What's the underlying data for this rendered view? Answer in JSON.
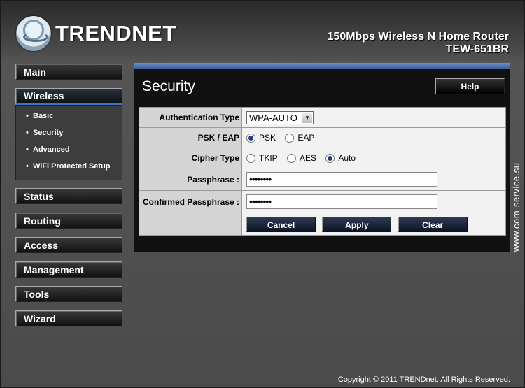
{
  "header": {
    "brand": "TRENDNET",
    "product_line": "150Mbps Wireless N Home Router",
    "model": "TEW-651BR"
  },
  "nav": {
    "main": "Main",
    "wireless": "Wireless",
    "wireless_sub": {
      "basic": "Basic",
      "security": "Security",
      "advanced": "Advanced",
      "wps": "WiFi Protected Setup"
    },
    "status": "Status",
    "routing": "Routing",
    "access": "Access",
    "management": "Management",
    "tools": "Tools",
    "wizard": "Wizard",
    "bullet": "•"
  },
  "panel": {
    "title": "Security",
    "help_label": "Help"
  },
  "form": {
    "auth_type_label": "Authentication Type",
    "auth_type_value": "WPA-AUTO",
    "psk_eap_label": "PSK / EAP",
    "psk_option": "PSK",
    "eap_option": "EAP",
    "psk_eap_selected": "PSK",
    "cipher_label": "Cipher Type",
    "cipher_tkip": "TKIP",
    "cipher_aes": "AES",
    "cipher_auto": "Auto",
    "cipher_selected": "Auto",
    "passphrase_label": "Passphrase :",
    "passphrase_mask": "••••••••",
    "confirm_label": "Confirmed Passphrase :",
    "confirm_mask": "••••••••",
    "cancel_label": "Cancel",
    "apply_label": "Apply",
    "clear_label": "Clear"
  },
  "footer": {
    "copyright": "Copyright © 2011 TRENDnet. All Rights Reserved.",
    "watermark": "www.com-service.su"
  },
  "colors": {
    "accent_blue": "#3c74c9",
    "panel_bar": "#5a7bb6"
  }
}
